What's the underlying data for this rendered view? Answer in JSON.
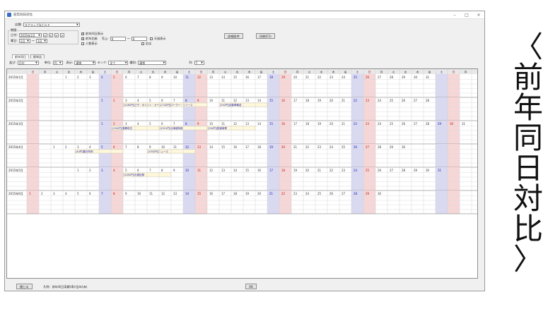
{
  "window": {
    "title": "前年同日対比",
    "minimize": "–",
    "maximize": "□",
    "close": "×"
  },
  "filters": {
    "shop_label": "店舗:",
    "shop_value": "スクラップ＆ビルド",
    "period_group": "期間",
    "date_label": "日付:",
    "date_value": "2015年1月",
    "week_label": "曜日:",
    "week_from": "1日",
    "week_to": "1日",
    "cb_ghost": "前年同日表示",
    "cb_ratio": "前年比較",
    "cb_people": "人数表示",
    "sales_label": "売上:",
    "sales_from": "0",
    "sales_to": "0",
    "cb_weather": "天候表示",
    "cb_all": "全店",
    "search_button": "検索(F1)",
    "print_button": "印刷(F2)",
    "cond_button": "詳細条件"
  },
  "tabs": [
    "前年同日",
    "前年比"
  ],
  "options_row": {
    "sort_label": "並び:",
    "sort_value": "日付",
    "unit_label": "単位:",
    "unit_value": "円",
    "disp_label": "表示:",
    "disp_value": "通常",
    "rank_label": "ランク:",
    "rank_value": "全て",
    "kind_label": "種別:",
    "kind_value": "通常",
    "col_label": "列:",
    "col_value": "7"
  },
  "calendar": {
    "weekday_headers": [
      "日",
      "月",
      "火",
      "水",
      "木",
      "金",
      "土"
    ],
    "month_labels": [
      "2015年1月",
      "2015年2月",
      "2015年3月",
      "2015年4月",
      "2015年5月",
      "2015年6月"
    ],
    "day_labels": [
      "1",
      "2",
      "3",
      "4",
      "5",
      "6",
      "7",
      "8",
      "9",
      "10",
      "11",
      "12",
      "13",
      "14",
      "15",
      "16",
      "17",
      "18",
      "19",
      "20",
      "21",
      "22",
      "23",
      "24",
      "25",
      "26",
      "27",
      "28",
      "29",
      "30",
      "31"
    ],
    "week_repeats": 5,
    "month_starts": [
      3,
      6,
      6,
      2,
      4,
      0
    ],
    "month_lengths": [
      31,
      28,
      31,
      30,
      31,
      30
    ],
    "colors": {
      "sat": "#d9d9f2",
      "sun": "#f6d6d6",
      "note": "#fff8dc",
      "header": "#e8e8e8",
      "blue": "#1a1ab0",
      "red": "#c01616"
    },
    "notes": [
      {
        "month": 1,
        "day": 3,
        "text": "[1262円]ピザ・ポイント・オーブン"
      },
      {
        "month": 1,
        "day": 6,
        "text": "[1742円]ローラー・リリース"
      },
      {
        "month": 1,
        "day": 11,
        "text": "[342円]自動車輸送"
      },
      {
        "month": 2,
        "day": 2,
        "text": "[1542円]春節前日"
      },
      {
        "month": 2,
        "day": 6,
        "text": "[1911円]北海道特設"
      },
      {
        "month": 2,
        "day": 10,
        "text": "[342円]鉄道事業"
      },
      {
        "month": 3,
        "day": 3,
        "text": "[44円]春分特売"
      },
      {
        "month": 3,
        "day": 9,
        "text": "[1542円]ニュース"
      },
      {
        "month": 4,
        "day": 5,
        "text": "[1092円]天候記録"
      }
    ]
  },
  "status": {
    "close_button": "閉じる",
    "legend": "凡例：前年同日実績(青)/当年(赤)",
    "ok_button": "OK"
  },
  "vertical_text": [
    "〈",
    "前",
    "年",
    "同",
    "日",
    "対",
    "比",
    "〉"
  ]
}
